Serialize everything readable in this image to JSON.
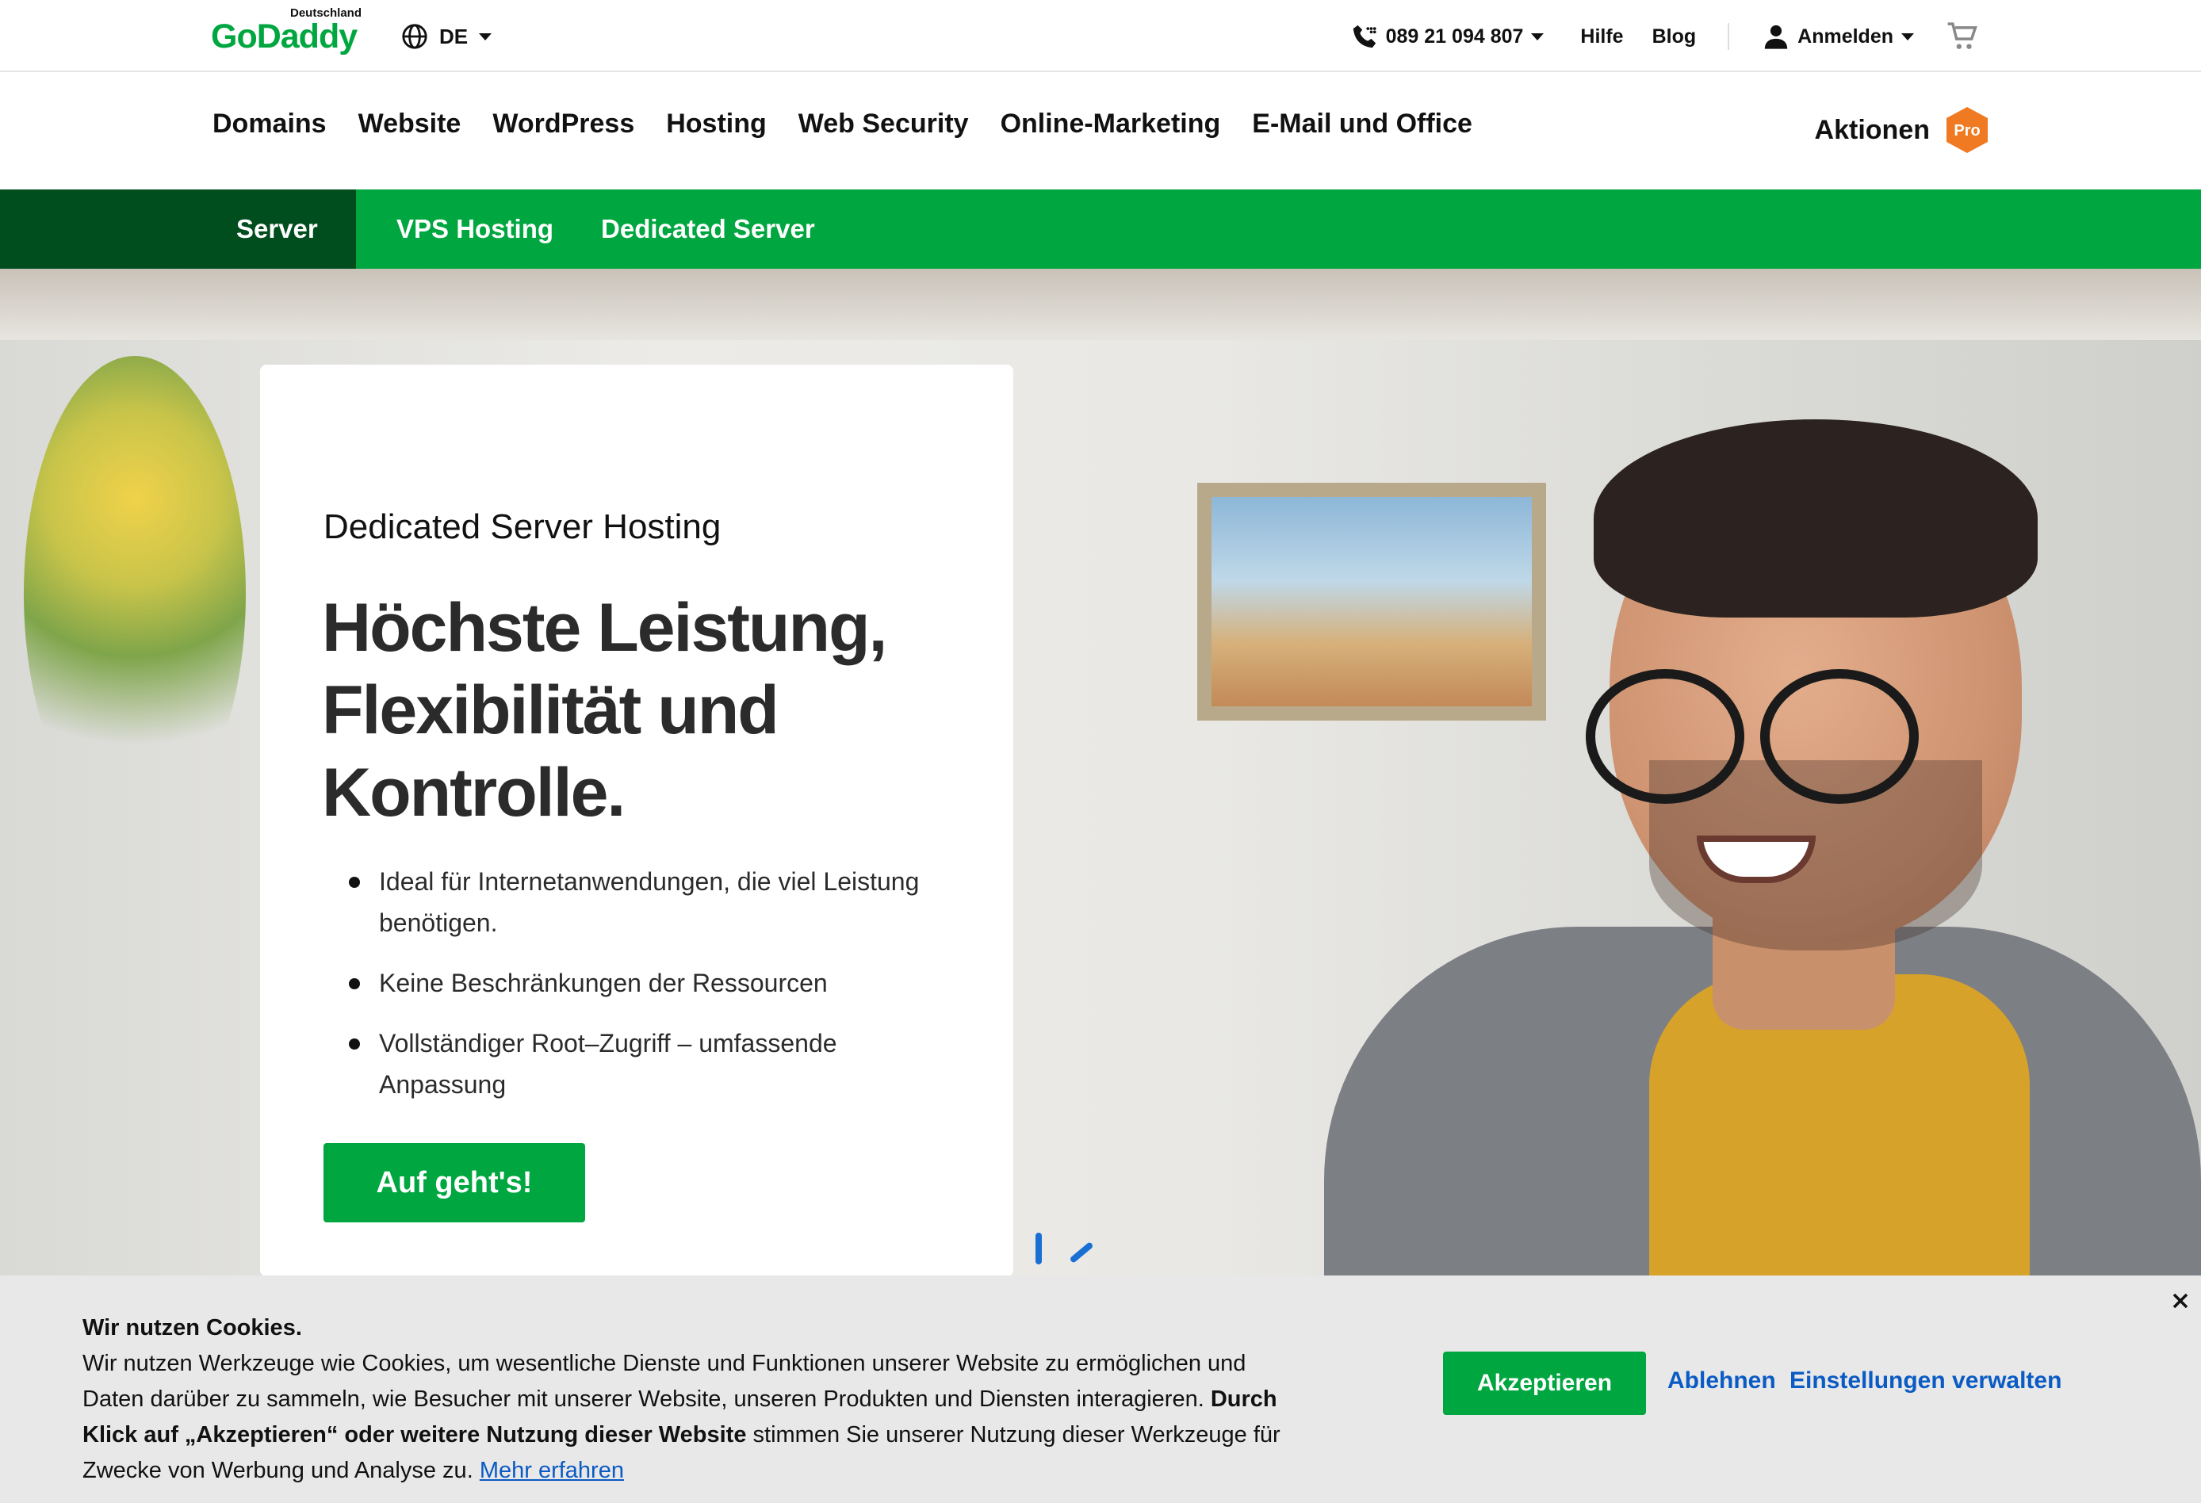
{
  "header": {
    "logo_country": "Deutschland",
    "logo_text": "GoDaddy",
    "language": "DE",
    "phone": "089 21 094 807",
    "help": "Hilfe",
    "blog": "Blog",
    "signin": "Anmelden"
  },
  "mainnav": {
    "items": [
      "Domains",
      "Website",
      "WordPress",
      "Hosting",
      "Web Security",
      "Online-Marketing",
      "E-Mail und Office"
    ],
    "promotions": "Aktionen",
    "pro_badge": "Pro"
  },
  "subnav": {
    "section": "Server",
    "items": [
      "VPS Hosting",
      "Dedicated Server"
    ],
    "active": "Dedicated Server"
  },
  "hero": {
    "eyebrow": "Dedicated Server Hosting",
    "headline_lines": [
      "Höchste Leistung,",
      "Flexibilität und",
      "Kontrolle."
    ],
    "bullets": [
      "Ideal für Internetanwendungen, die viel Leistung benötigen.",
      "Keine Beschränkungen der Ressourcen",
      "Vollständiger Root–Zugriff – umfassende Anpassung"
    ],
    "cta": "Auf geht's!"
  },
  "cookie": {
    "title": "Wir nutzen Cookies.",
    "body1": "Wir nutzen Werkzeuge wie Cookies, um wesentliche Dienste und Funktionen unserer Website zu ermöglichen und Daten darüber zu sammeln, wie Besucher mit unserer Website, unseren Produkten und Diensten interagieren.",
    "bold": "Durch Klick auf „Akzeptieren“ oder weitere Nutzung dieser Website",
    "body2": " stimmen Sie unserer Nutzung dieser Werkzeuge für Zwecke von Werbung und Analyse zu. ",
    "more_link": "Mehr erfahren",
    "accept": "Akzeptieren",
    "decline": "Ablehnen",
    "settings": "Einstellungen verwalten"
  },
  "colors": {
    "brand_green": "#00a63f",
    "dark_green": "#004d1e",
    "pro_orange": "#f07a21",
    "link_blue": "#0a5bc4"
  },
  "icons": {
    "language": "globe-icon",
    "phone": "phone-icon",
    "account": "user-icon",
    "cart": "cart-icon",
    "close": "close-icon"
  }
}
